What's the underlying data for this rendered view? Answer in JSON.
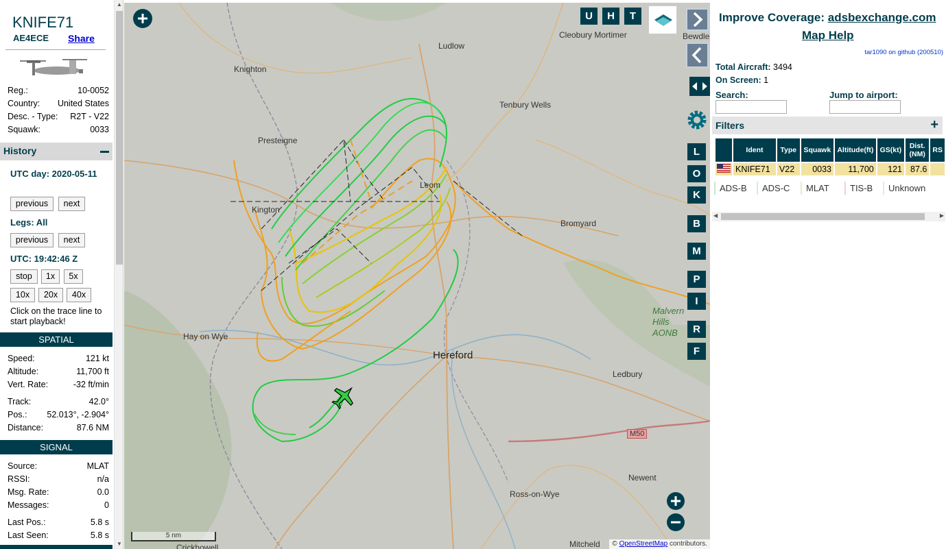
{
  "aircraft": {
    "callsign": "KNIFE71",
    "icao": "AE4ECE",
    "share_label": "Share",
    "fields": [
      {
        "label": "Reg.:",
        "value": "10-0052"
      },
      {
        "label": "Country:",
        "value": "United States"
      },
      {
        "label": "Desc. - Type:",
        "value": "R2T - V22"
      },
      {
        "label": "Squawk:",
        "value": "0033"
      }
    ]
  },
  "history": {
    "title": "History",
    "utc_day": "UTC day: 2020-05-11",
    "legs": "Legs: All",
    "utc_time": "UTC: 19:42:46 Z",
    "prev_label": "previous",
    "next_label": "next",
    "speeds": [
      "stop",
      "1x",
      "5x",
      "10x",
      "20x",
      "40x"
    ],
    "hint": "Click on the trace line to start playback!"
  },
  "spatial": {
    "title": "SPATIAL",
    "fields": [
      {
        "label": "Speed:",
        "value": "121 kt"
      },
      {
        "label": "Altitude:",
        "value": "11,700 ft"
      },
      {
        "label": "Vert. Rate:",
        "value": "-32 ft/min"
      },
      {
        "label": "Track:",
        "value": "42.0°"
      },
      {
        "label": "Pos.:",
        "value": "52.013°, -2.904°"
      },
      {
        "label": "Distance:",
        "value": "87.6 NM"
      }
    ]
  },
  "signal": {
    "title": "SIGNAL",
    "fields": [
      {
        "label": "Source:",
        "value": "MLAT"
      },
      {
        "label": "RSSI:",
        "value": "n/a"
      },
      {
        "label": "Msg. Rate:",
        "value": "0.0"
      },
      {
        "label": "Messages:",
        "value": "0"
      },
      {
        "label": "Last Pos.:",
        "value": "5.8 s"
      },
      {
        "label": "Last Seen:",
        "value": "5.8 s"
      }
    ]
  },
  "map": {
    "towns": [
      "Ludlow",
      "Cleobury Mortimer",
      "Bewdle",
      "Knighton",
      "Tenbury Wells",
      "Presteigne",
      "Leom",
      "Kington",
      "Bromyard",
      "Malvern Hills AONB",
      "Hay on Wye",
      "Hereford",
      "Ledbury",
      "Newent",
      "Ross-on-Wye",
      "Crickhowell",
      "Mitcheld"
    ],
    "road_shield": "M50",
    "top_buttons": [
      "U",
      "H",
      "T"
    ],
    "side_buttons": [
      "L",
      "O",
      "K",
      "B",
      "M",
      "P",
      "I",
      "R",
      "F"
    ],
    "scale_label": "5 nm",
    "attribution_prefix": "© ",
    "attribution_link": "OpenStreetMap",
    "attribution_suffix": " contributors.",
    "colors": {
      "trace_green": "#22cc44",
      "trace_yellow": "#e8c400",
      "trace_orange": "#f0a020",
      "ui_teal": "#003d4c"
    }
  },
  "sidebar": {
    "improve_text": "Improve Coverage: ",
    "improve_link": "adsbexchange.com",
    "map_help": "Map Help",
    "version": "tar1090 on github (200510)",
    "total_label": "Total Aircraft:",
    "total_value": "3494",
    "onscreen_label": "On Screen:",
    "onscreen_value": "1",
    "search_label": "Search:",
    "jump_label": "Jump to airport:",
    "filters_label": "Filters",
    "table": {
      "headers": [
        "Ident",
        "Type",
        "Squawk",
        "Altitude(ft)",
        "GS(kt)",
        "Dist. (NM)",
        "RS"
      ],
      "rows": [
        {
          "flag": "us-flag-icon",
          "ident": "KNIFE71",
          "type": "V22",
          "squawk": "0033",
          "altitude": "11,700",
          "gs": "121",
          "dist": "87.6"
        }
      ]
    },
    "legend": [
      "ADS-B",
      "ADS-C",
      "MLAT",
      "TIS-B",
      "Unknown"
    ]
  }
}
